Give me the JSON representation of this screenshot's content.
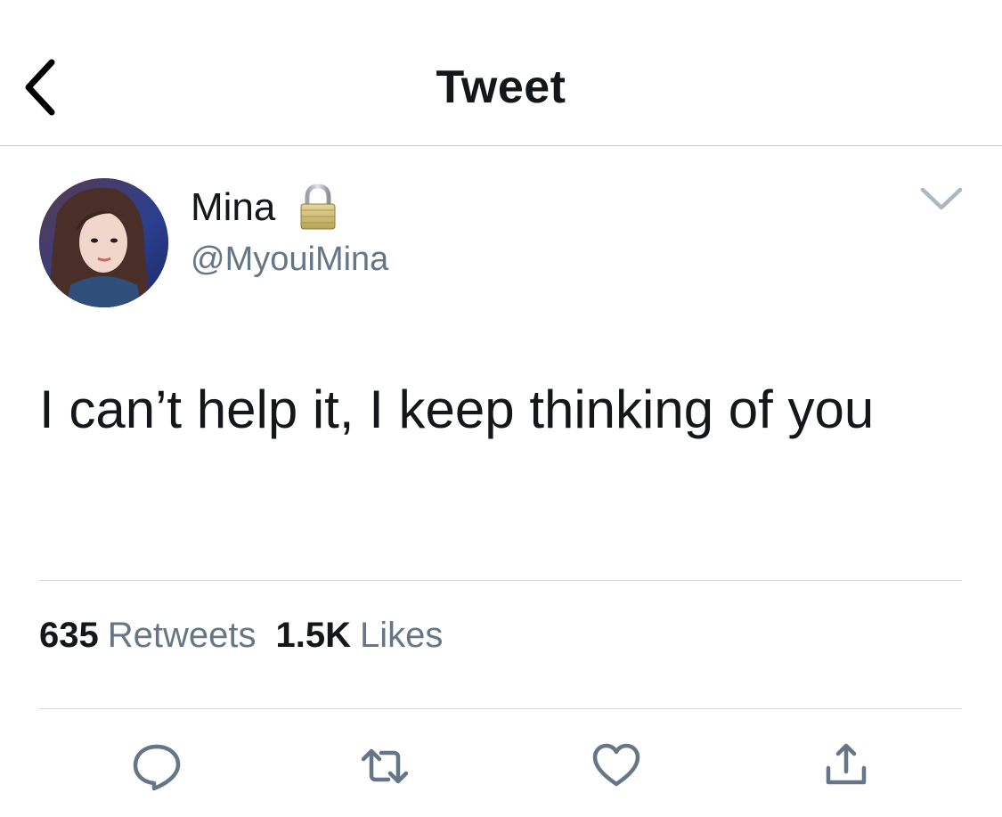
{
  "nav": {
    "title": "Tweet",
    "back_icon": "chevron-left-icon"
  },
  "tweet": {
    "author": {
      "display_name": "Mina",
      "handle": "@MyouiMina",
      "protected_icon": "lock-icon",
      "avatar": "profile-photo"
    },
    "menu_icon": "chevron-down-icon",
    "text": "I can’t help it, I keep thinking of you",
    "stats": {
      "retweets_count": "635",
      "retweets_label": "Retweets",
      "likes_count": "1.5K",
      "likes_label": "Likes"
    }
  },
  "actions": [
    {
      "name": "reply",
      "icon": "reply-icon"
    },
    {
      "name": "retweet",
      "icon": "retweet-icon"
    },
    {
      "name": "like",
      "icon": "heart-icon"
    },
    {
      "name": "share",
      "icon": "share-icon"
    }
  ],
  "colors": {
    "primary_text": "#14171a",
    "secondary_text": "#657786",
    "icon_gray": "#657786",
    "divider": "#d6dadd"
  }
}
